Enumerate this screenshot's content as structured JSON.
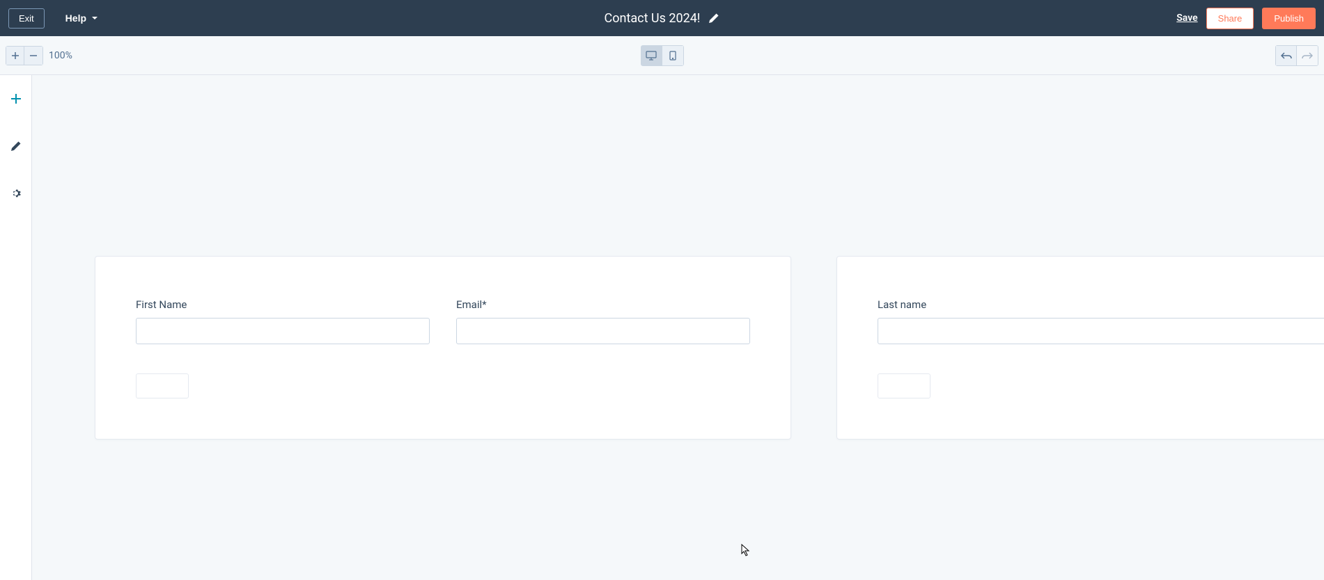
{
  "header": {
    "exit_label": "Exit",
    "help_label": "Help",
    "title": "Contact Us 2024!",
    "save_label": "Save",
    "share_label": "Share",
    "publish_label": "Publish"
  },
  "toolbar": {
    "zoom_level": "100%"
  },
  "canvas": {
    "form1": {
      "fields": [
        {
          "label": "First Name"
        },
        {
          "label": "Email*"
        }
      ]
    },
    "form2": {
      "fields": [
        {
          "label": "Last name"
        }
      ]
    }
  }
}
